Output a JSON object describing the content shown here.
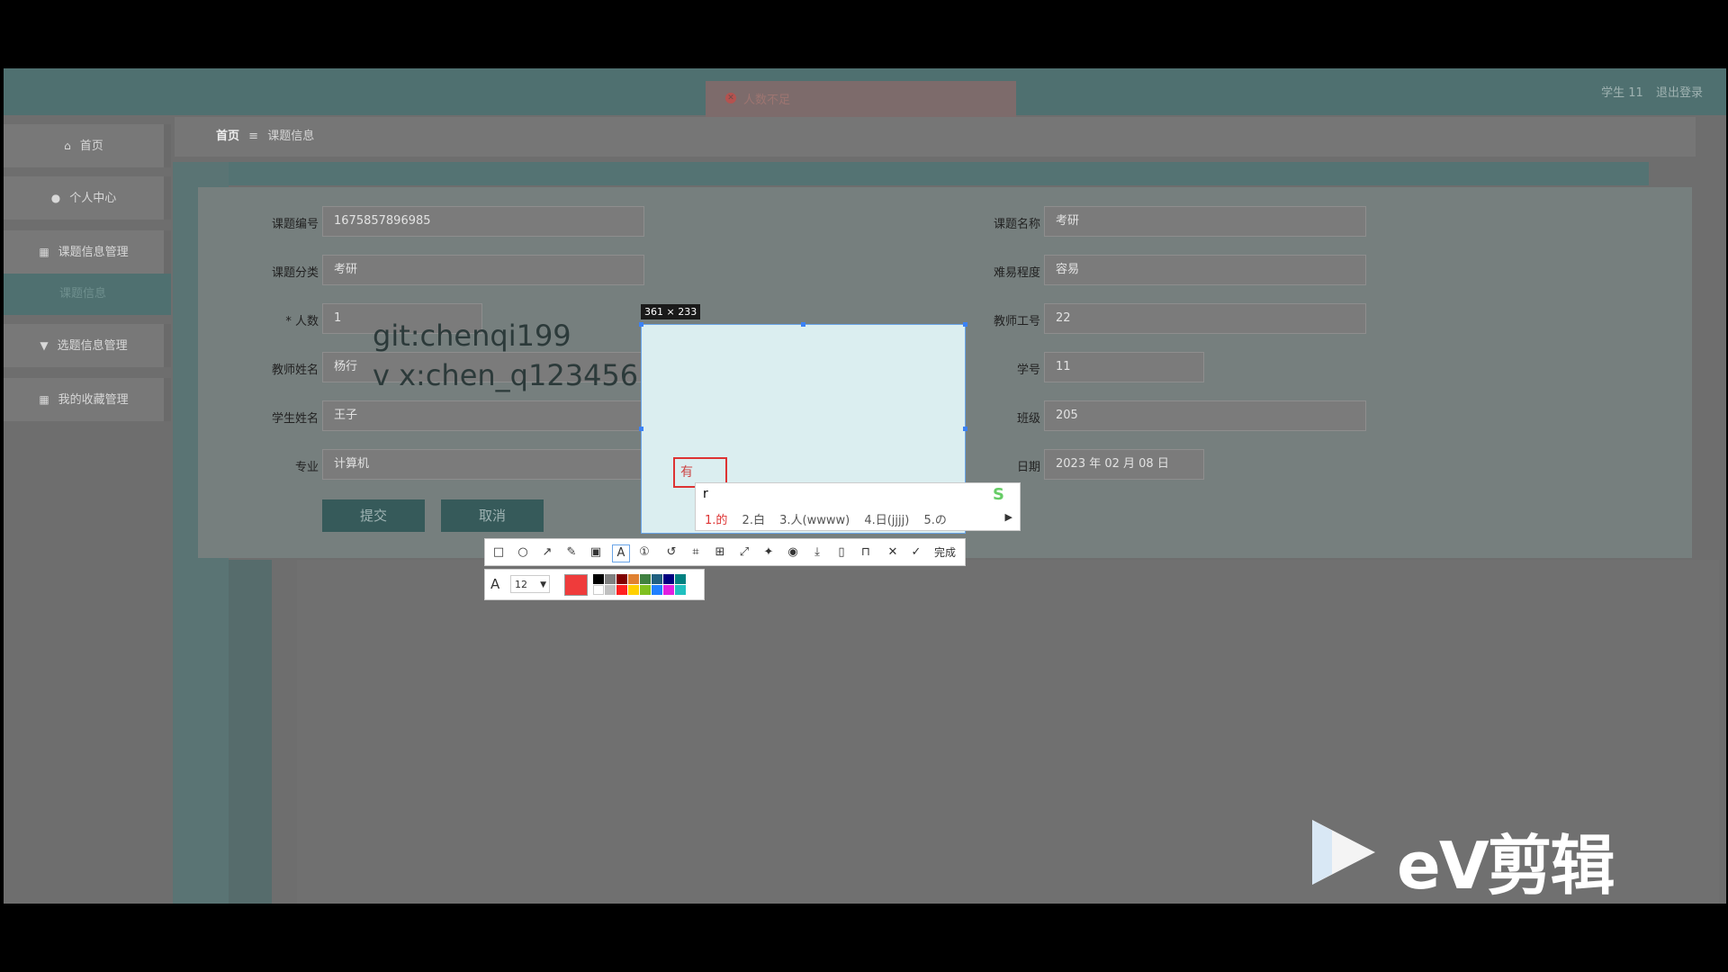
{
  "header": {
    "alert_text": "人数不足",
    "alert_highlight": "足",
    "user_label": "学生 11",
    "logout_label": "退出登录"
  },
  "sidebar": {
    "items": [
      {
        "label": "首页",
        "icon": "home-icon"
      },
      {
        "label": "个人中心",
        "icon": "user-icon"
      },
      {
        "label": "课题信息管理",
        "icon": "grid-icon"
      },
      {
        "label": "课题信息",
        "icon": ""
      },
      {
        "label": "选题信息管理",
        "icon": "pin-icon"
      },
      {
        "label": "我的收藏管理",
        "icon": "grid-icon"
      }
    ]
  },
  "breadcrumb": {
    "home": "首页",
    "sep": "≡",
    "current": "课题信息"
  },
  "form": {
    "left": [
      {
        "label": "课题编号",
        "value": "1675857896985"
      },
      {
        "label": "课题分类",
        "value": "考研"
      },
      {
        "label": "* 人数",
        "value": "1"
      },
      {
        "label": "教师姓名",
        "value": "杨行"
      },
      {
        "label": "学生姓名",
        "value": "王子"
      },
      {
        "label": "专业",
        "value": "计算机"
      }
    ],
    "right": [
      {
        "label": "课题名称",
        "value": "考研"
      },
      {
        "label": "难易程度",
        "value": "容易"
      },
      {
        "label": "教师工号",
        "value": "22"
      },
      {
        "label": "学号",
        "value": "11"
      },
      {
        "label": "班级",
        "value": "205"
      },
      {
        "label": "日期",
        "value": "2023 年 02 月 08 日"
      }
    ],
    "submit_label": "提交",
    "cancel_label": "取消"
  },
  "screenshot_tool": {
    "dimension_label": "361 × 233",
    "text_box_value": "有",
    "ime_composition": "r",
    "ime_candidates": [
      "1.的",
      "2.白",
      "3.人(wwww)",
      "4.日(jjjj)",
      "5.の"
    ],
    "done_label": "完成",
    "font_size": "12",
    "active_color": "#ef3b3b",
    "palette": [
      "#000000",
      "#808080",
      "#800000",
      "#808000",
      "#008000",
      "#008080",
      "#000080",
      "#800080",
      "#ffffff",
      "#c0c0c0",
      "#ff0000",
      "#ffff00",
      "#00ff00",
      "#00ffff",
      "#0000ff",
      "#ff00ff"
    ]
  },
  "watermark": {
    "line1": "git:chenqi199",
    "line2": "v x:chen_q123456"
  },
  "video_logo": {
    "text": "eV剪辑"
  }
}
